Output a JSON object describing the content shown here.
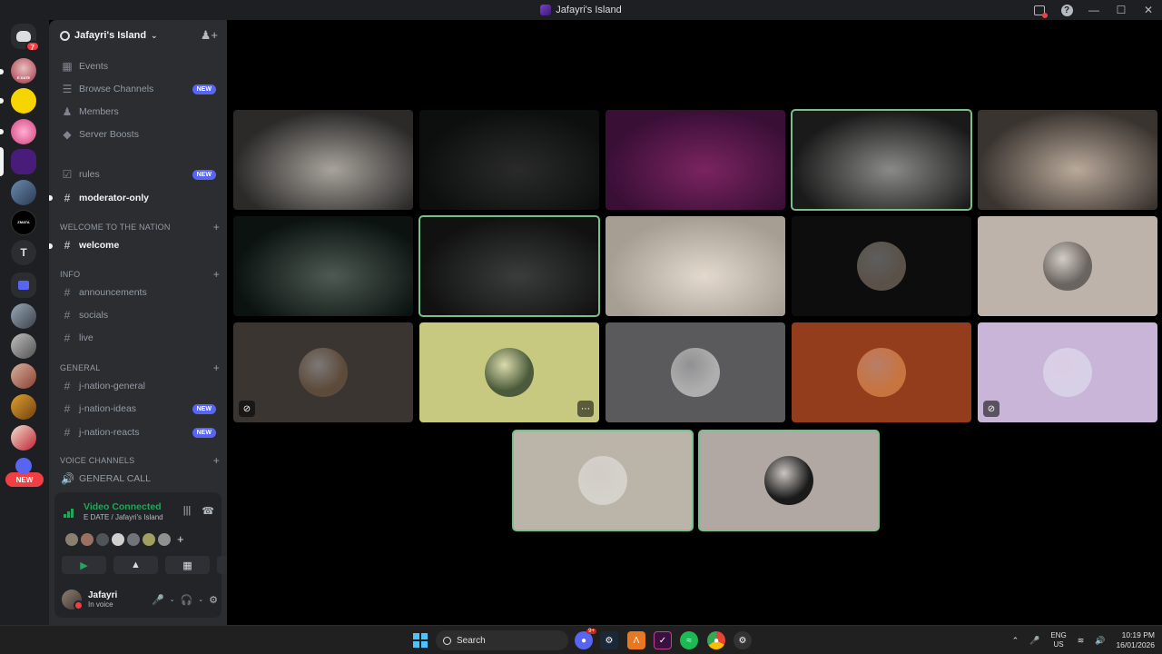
{
  "window": {
    "title": "Jafayri's Island"
  },
  "rail": {
    "dm_badge": "7",
    "new_pill": "NEW",
    "text_server_letter": "T",
    "edate_label": "E DATE",
    "zmata_label": "ZMATA"
  },
  "server": {
    "name": "Jafayri's Island"
  },
  "sidebar": {
    "top_items": [
      {
        "label": "Events",
        "icon": "calendar-icon"
      },
      {
        "label": "Browse Channels",
        "icon": "browse-icon",
        "badge": "NEW"
      },
      {
        "label": "Members",
        "icon": "members-icon"
      },
      {
        "label": "Server Boosts",
        "icon": "boost-icon"
      }
    ],
    "channels": {
      "rules": {
        "label": "rules",
        "badge": "NEW"
      },
      "moderator_only": {
        "label": "moderator-only"
      }
    },
    "categories": {
      "welcome": "WELCOME TO THE NATION",
      "info": "INFO",
      "general": "GENERAL",
      "voice": "VOICE CHANNELS"
    },
    "welcome_channels": [
      "welcome"
    ],
    "info_channels": [
      "announcements",
      "socials",
      "live"
    ],
    "general_channels": [
      {
        "label": "j-nation-general"
      },
      {
        "label": "j-nation-ideas",
        "badge": "NEW"
      },
      {
        "label": "j-nation-reacts",
        "badge": "NEW"
      }
    ],
    "voice_channels": [
      "GENERAL CALL"
    ]
  },
  "voice_panel": {
    "status": "Video Connected",
    "location": "E DATE / Jafayri's Island",
    "participants_count_shown": 7
  },
  "user": {
    "name": "Jafayri",
    "status": "In voice"
  },
  "video_tiles": [
    {
      "kind": "video",
      "colors": [
        "#2b2a29",
        "#a8a39c"
      ],
      "speaking": false
    },
    {
      "kind": "video",
      "colors": [
        "#0d0f0f",
        "#2a2a2a"
      ],
      "speaking": false
    },
    {
      "kind": "video",
      "colors": [
        "#3a0f36",
        "#7a2460"
      ],
      "speaking": false
    },
    {
      "kind": "video",
      "colors": [
        "#1a1a1a",
        "#8a8a88"
      ],
      "speaking": true
    },
    {
      "kind": "video",
      "colors": [
        "#3a3430",
        "#b9a99a"
      ],
      "speaking": false
    },
    {
      "kind": "video",
      "colors": [
        "#0b1210",
        "#4d5a52"
      ],
      "speaking": false
    },
    {
      "kind": "video",
      "colors": [
        "#111",
        "#3a3d3c"
      ],
      "speaking": true
    },
    {
      "kind": "video",
      "colors": [
        "#a69e93",
        "#e3d9cd"
      ],
      "speaking": false
    },
    {
      "kind": "avatar",
      "bg": "#0d0d0d",
      "avatar": "#5a5148",
      "speaking": false
    },
    {
      "kind": "avatar",
      "bg": "#bdb3aa",
      "avatar": "#6a6460",
      "speaking": false
    },
    {
      "kind": "avatar",
      "bg": "#3b3532",
      "avatar": "#5c4a3a",
      "speaking": false,
      "muted": true
    },
    {
      "kind": "avatar",
      "bg": "#c8c981",
      "avatar": "#4a5a3a",
      "speaking": false,
      "more": true
    },
    {
      "kind": "avatar",
      "bg": "#5a5a5d",
      "avatar": "#aeaeae",
      "speaking": false
    },
    {
      "kind": "avatar",
      "bg": "#943d1d",
      "avatar": "#c8743f",
      "speaking": false
    },
    {
      "kind": "avatar",
      "bg": "#c8b5d8",
      "avatar": "#d8d0e6",
      "speaking": false,
      "muted": true
    },
    {
      "kind": "avatar",
      "bg": "#bbb4a9",
      "avatar": "#d5d1cb",
      "speaking": true
    },
    {
      "kind": "avatar",
      "bg": "#b1a8a3",
      "avatar": "#1a1a1a",
      "speaking": true
    }
  ],
  "taskbar": {
    "search_placeholder": "Search",
    "discord_badge": "9+",
    "lang_line1": "ENG",
    "lang_line2": "US",
    "time": "10:19 PM",
    "date": "16/01/2026"
  }
}
